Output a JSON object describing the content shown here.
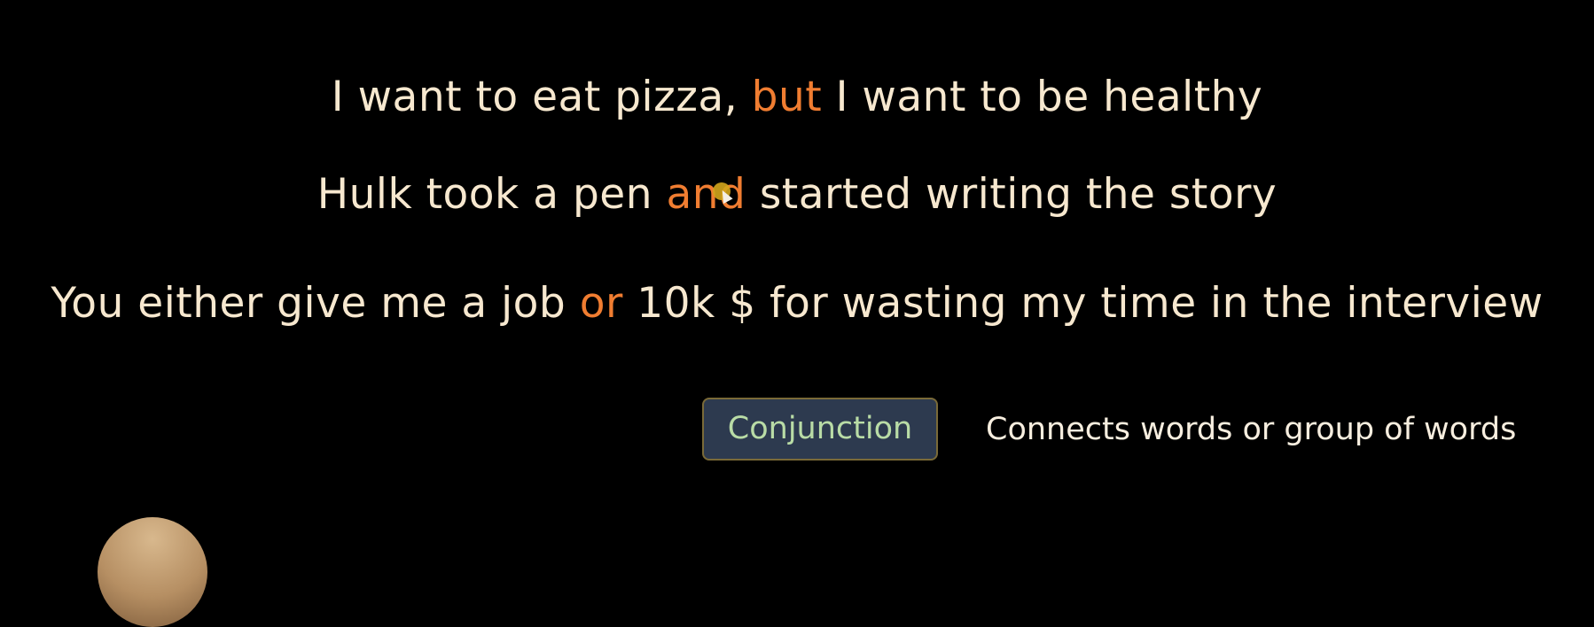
{
  "sentences": [
    {
      "before": "I want to eat pizza, ",
      "conjunction": "but",
      "after": " I want to be healthy"
    },
    {
      "before": "Hulk took a pen ",
      "conjunction": "and",
      "after": " started writing the story"
    },
    {
      "before": "You either give me a job ",
      "conjunction": "or",
      "after": " 10k $ for wasting my time in the interview"
    }
  ],
  "concept": {
    "label": "Conjunction",
    "definition": "Connects words or group of words"
  },
  "colors": {
    "background": "#000000",
    "sentence_text": "#f7e8cf",
    "conjunction_highlight": "#f07d31",
    "chip_background": "#2d3a4f",
    "chip_text": "#b9dca6",
    "cursor_dot": "#d3a51c"
  },
  "icons": {
    "cursor": "mouse-pointer-icon",
    "avatar": "presenter-avatar"
  }
}
